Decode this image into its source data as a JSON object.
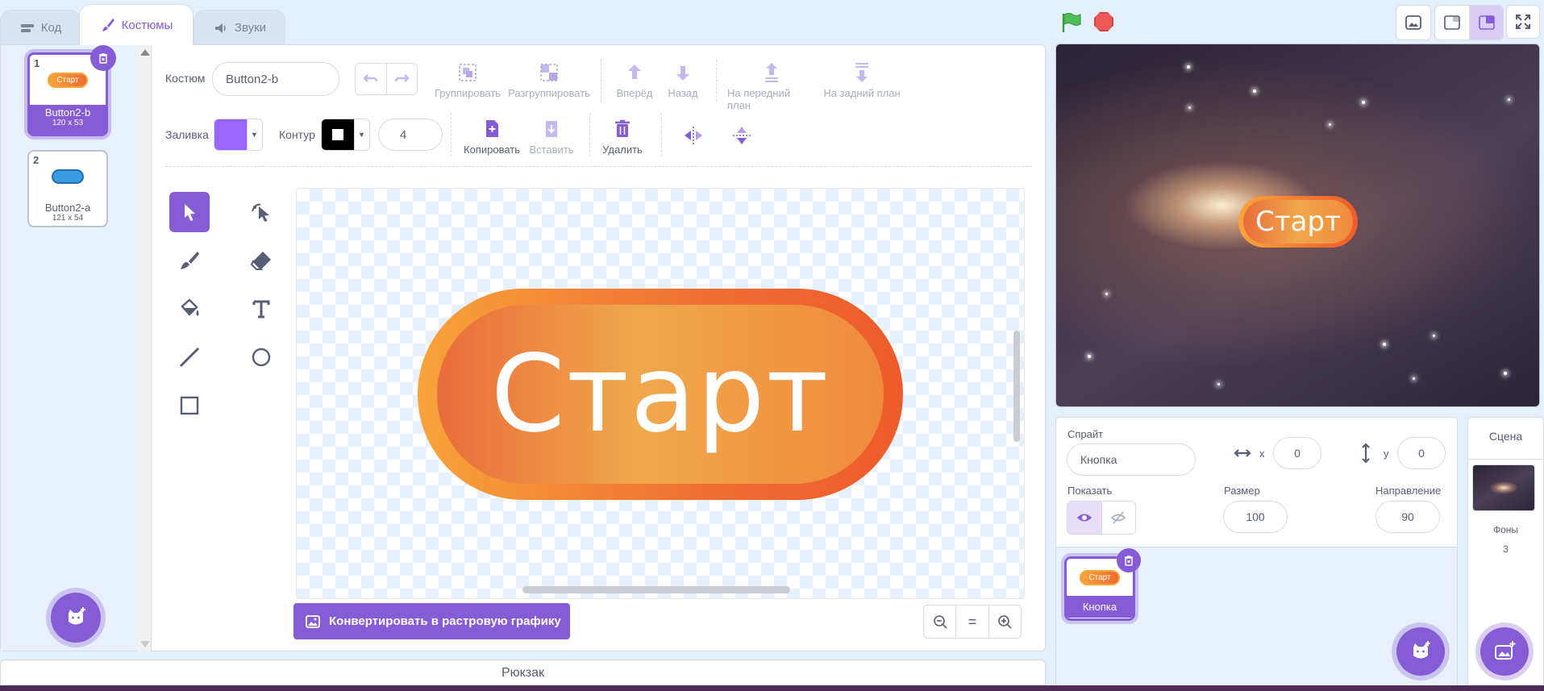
{
  "tabs": [
    {
      "label": "Код",
      "icon": "code-icon"
    },
    {
      "label": "Костюмы",
      "icon": "brush-icon"
    },
    {
      "label": "Звуки",
      "icon": "speaker-icon"
    }
  ],
  "costumes": [
    {
      "number": "1",
      "name": "Button2-b",
      "size": "120 x 53",
      "thumb_text": "Старт",
      "selected": true
    },
    {
      "number": "2",
      "name": "Button2-a",
      "size": "121 x 54",
      "selected": false
    }
  ],
  "toolbar": {
    "costume_label": "Костюм",
    "costume_name": "Button2-b",
    "group": "Группировать",
    "ungroup": "Разгруппировать",
    "forward": "Вперёд",
    "backward": "Назад",
    "front": "На передний план",
    "back": "На задний план",
    "fill_label": "Заливка",
    "fill_color": "#9966ff",
    "outline_label": "Контур",
    "outline_color": "#000000",
    "outline_width": "4",
    "copy": "Копировать",
    "paste": "Вставить",
    "delete": "Удалить"
  },
  "canvas": {
    "button_text": "Старт",
    "convert_label": "Конвертировать в растровую графику",
    "zoom_reset": "="
  },
  "backpack": "Рюкзак",
  "stage": {
    "button_text": "Старт"
  },
  "sprite_info": {
    "sprite_label": "Спрайт",
    "sprite_name": "Кнопка",
    "x_label": "x",
    "x_value": "0",
    "y_label": "y",
    "y_value": "0",
    "show_label": "Показать",
    "size_label": "Размер",
    "size_value": "100",
    "direction_label": "Направление",
    "direction_value": "90"
  },
  "sprites": [
    {
      "name": "Кнопка",
      "thumb_text": "Старт"
    }
  ],
  "scene": {
    "title": "Сцена",
    "backdrops_label": "Фоны",
    "backdrops_count": "3"
  },
  "colors": {
    "accent": "#855cd6",
    "button_orange": "#ef6e33"
  }
}
